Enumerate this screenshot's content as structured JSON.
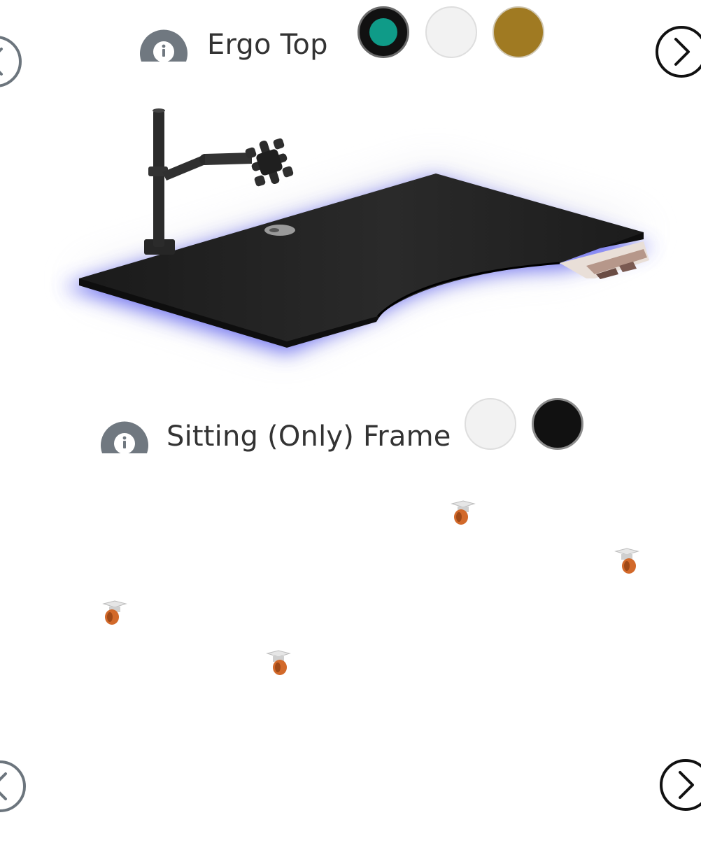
{
  "top_section": {
    "title": "Ergo Top",
    "info_icon": "info-icon",
    "swatches": [
      {
        "name": "teal",
        "color": "#0f9b88",
        "selected": true
      },
      {
        "name": "white",
        "color": "#f2f2f2",
        "selected": false
      },
      {
        "name": "gold",
        "color": "#a07a22",
        "selected": false
      }
    ],
    "prev_icon": "chevron-left-icon",
    "next_icon": "chevron-right-icon"
  },
  "frame_section": {
    "title": "Sitting (Only) Frame",
    "info_icon": "info-icon",
    "swatches": [
      {
        "name": "white",
        "color": "#f2f2f2",
        "selected": false
      },
      {
        "name": "black",
        "color": "#111111",
        "selected": false
      }
    ],
    "prev_icon": "chevron-left-icon",
    "next_icon": "chevron-right-icon"
  },
  "colors": {
    "icon_grey": "#707880",
    "text": "#333333",
    "desk_top": "#1e1e1e",
    "underglow": "#5b5ff0",
    "caster_wheel": "#d2692a",
    "caster_plate": "#e6e6e6"
  }
}
